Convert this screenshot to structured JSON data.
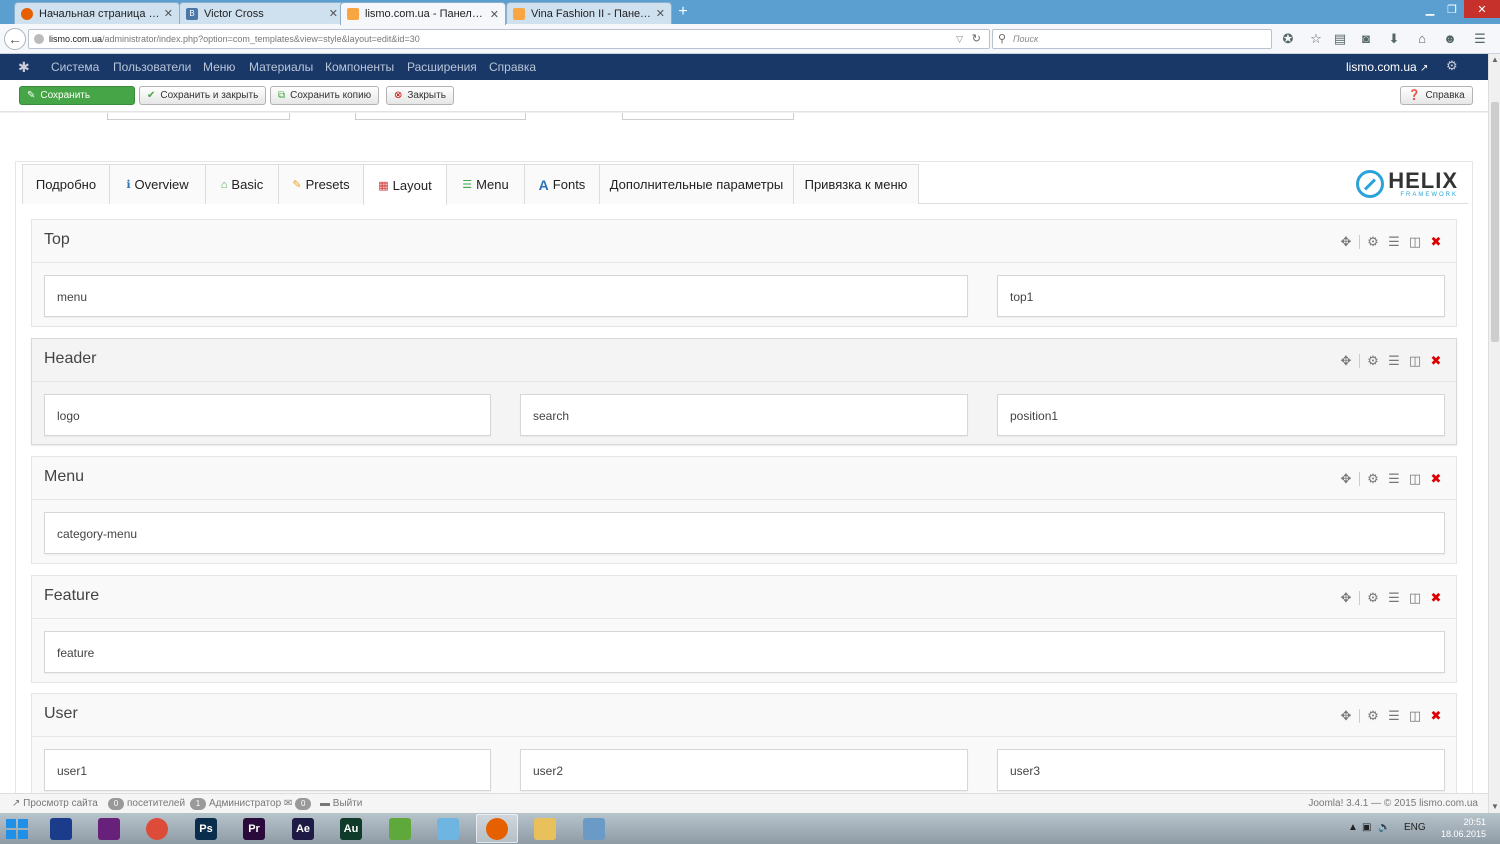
{
  "browser": {
    "tabs": [
      {
        "label": "Начальная страница Mozi...",
        "favicon_color": "#e66000"
      },
      {
        "label": "Victor Cross",
        "favicon_color": "#4a76a8"
      },
      {
        "label": "lismo.com.ua - Панель уп...",
        "favicon_color": "#f9a541"
      },
      {
        "label": "Vina Fashion II - Панель у...",
        "favicon_color": "#f9a541"
      }
    ],
    "active_tab": 2,
    "url_host": "lismo.com.ua",
    "url_path": "/administrator/index.php?option=com_templates&view=style&layout=edit&id=30",
    "search_placeholder": "Поиск"
  },
  "admin_menu": {
    "items": [
      "Система",
      "Пользователи",
      "Меню",
      "Материалы",
      "Компоненты",
      "Расширения",
      "Справка"
    ],
    "site_link": "lismo.com.ua"
  },
  "toolbar": {
    "save": "Сохранить",
    "save_close": "Сохранить и закрыть",
    "save_copy": "Сохранить копию",
    "close": "Закрыть",
    "help": "Справка"
  },
  "tabs": [
    {
      "label": "Подробно",
      "icon": ""
    },
    {
      "label": "Overview",
      "icon": "info-icon"
    },
    {
      "label": "Basic",
      "icon": "home-icon"
    },
    {
      "label": "Presets",
      "icon": "pencil-icon"
    },
    {
      "label": "Layout",
      "icon": "grid-icon"
    },
    {
      "label": "Menu",
      "icon": "list-icon"
    },
    {
      "label": "Fonts",
      "icon": "font-icon"
    },
    {
      "label": "Дополнительные параметры",
      "icon": ""
    },
    {
      "label": "Привязка к меню",
      "icon": ""
    }
  ],
  "active_tab": "Layout",
  "helix": {
    "brand": "HELIX",
    "sub": "FRAMEWORK",
    "color": "#29a3d9"
  },
  "sections": [
    {
      "title": "Top",
      "positions": [
        "menu",
        "top1"
      ]
    },
    {
      "title": "Header",
      "positions": [
        "logo",
        "search",
        "position1"
      ]
    },
    {
      "title": "Menu",
      "positions": [
        "category-menu"
      ]
    },
    {
      "title": "Feature",
      "positions": [
        "feature"
      ]
    },
    {
      "title": "User",
      "positions": [
        "user1",
        "user2",
        "user3"
      ]
    }
  ],
  "status_bar": {
    "view_site": "Просмотр сайта",
    "visitors_count": "0",
    "visitors_label": "посетителей",
    "admins_count": "1",
    "admins_label": "Администратор",
    "messages_count": "0",
    "logout": "Выйти",
    "copyright": "Joomla! 3.4.1 — © 2015 lismo.com.ua"
  },
  "taskbar": {
    "apps": [
      {
        "name": "save",
        "label": "",
        "color": "#1a3c8a"
      },
      {
        "name": "visual-studio",
        "label": "",
        "color": "#68217a"
      },
      {
        "name": "chrome",
        "label": "",
        "color": "#dd4b39"
      },
      {
        "name": "photoshop",
        "label": "Ps",
        "color": "#0b2d4d"
      },
      {
        "name": "premiere",
        "label": "Pr",
        "color": "#2a0a3a"
      },
      {
        "name": "after-effects",
        "label": "Ae",
        "color": "#1d1a45"
      },
      {
        "name": "audition",
        "label": "Au",
        "color": "#0f3b2a"
      },
      {
        "name": "utorrent",
        "label": "",
        "color": "#5fa83b"
      },
      {
        "name": "notepad",
        "label": "",
        "color": "#6fb5e2"
      },
      {
        "name": "firefox",
        "label": "",
        "color": "#e66000"
      },
      {
        "name": "explorer",
        "label": "",
        "color": "#e8c15c"
      },
      {
        "name": "paint",
        "label": "",
        "color": "#6a9bc7"
      }
    ],
    "active_app": 9,
    "lang": "ENG",
    "time": "20:51",
    "date": "18.06.2015"
  }
}
